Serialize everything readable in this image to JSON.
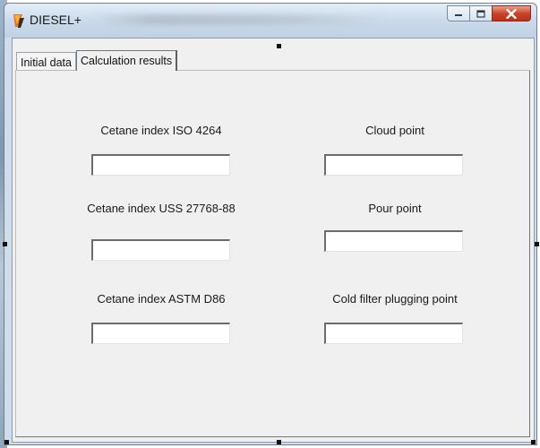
{
  "window": {
    "title": "DIESEL+",
    "buttons": {
      "minimize": "minimize",
      "maximize": "maximize",
      "close": "close"
    }
  },
  "tabs": [
    {
      "label": "Initial data",
      "active": false
    },
    {
      "label": "Calculation results",
      "active": true
    }
  ],
  "results": {
    "left": [
      {
        "label": "Cetane index ISO 4264",
        "value": ""
      },
      {
        "label": "Cetane index USS 27768-88",
        "value": ""
      },
      {
        "label": "Cetane index ASTM D86",
        "value": ""
      }
    ],
    "right": [
      {
        "label": "Cloud point",
        "value": ""
      },
      {
        "label": "Pour point",
        "value": ""
      },
      {
        "label": "Cold filter plugging point",
        "value": ""
      }
    ]
  },
  "icons": {
    "app": "fire-app-icon",
    "minimize": "minimize-icon",
    "maximize": "maximize-icon",
    "close": "close-icon"
  },
  "colors": {
    "title_bar": "#cddcec",
    "close_button": "#c9442a",
    "client_bg": "#f0f0f0"
  }
}
